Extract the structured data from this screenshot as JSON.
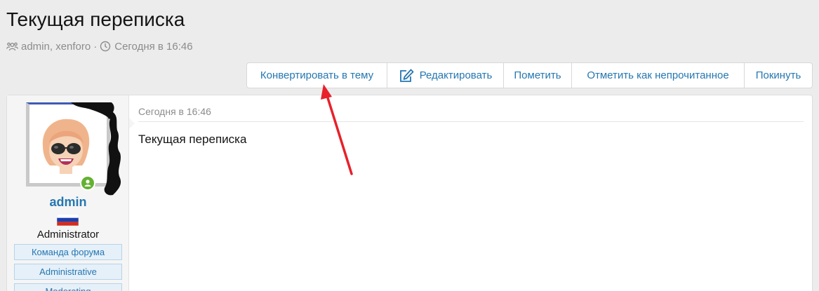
{
  "page": {
    "title": "Текущая переписка",
    "participants": "admin, xenforo",
    "separator": "·",
    "date": "Сегодня в 16:46"
  },
  "icons": {
    "participants": "users-icon",
    "date": "clock-icon",
    "edit": "edit-icon",
    "online": "online-user-icon"
  },
  "toolbar": {
    "convert_label": "Конвертировать в тему",
    "edit_label": "Редактировать",
    "mark_label": "Пометить",
    "unread_label": "Отметить как непрочитанное",
    "leave_label": "Покинуть"
  },
  "message": {
    "username": "admin",
    "user_title": "Administrator",
    "banners": [
      "Команда форума",
      "Administrative",
      "Moderating"
    ],
    "date": "Сегодня в 16:46",
    "body": "Текущая переписка"
  },
  "colors": {
    "link": "#2577b1",
    "online": "#63b132",
    "annotation_arrow": "#e8202a"
  }
}
